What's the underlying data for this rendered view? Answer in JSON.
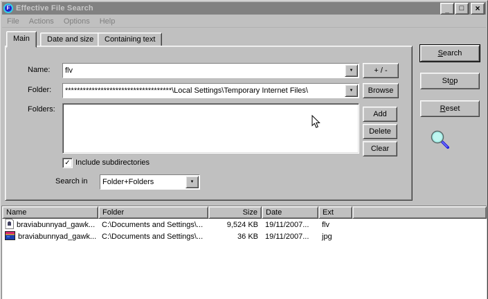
{
  "window": {
    "title": "Effective File Search",
    "icon_letter": "F",
    "controls": {
      "minimize": "_",
      "maximize": "□",
      "close": "×"
    }
  },
  "menu": {
    "items": [
      "File",
      "Actions",
      "Options",
      "Help"
    ]
  },
  "tabs": {
    "main": "Main",
    "date_size": "Date and size",
    "containing": "Containing text"
  },
  "form": {
    "name_label": "Name:",
    "name_value": "flv",
    "plusminus_label": "+ / -",
    "folder_label": "Folder:",
    "folder_value": "************************************\\Local Settings\\Temporary Internet Files\\",
    "browse_label": "Browse",
    "folders_label": "Folders:",
    "add_label": "Add",
    "delete_label": "Delete",
    "clear_label": "Clear",
    "include_sub_label": "Include subdirectories",
    "include_sub_checked": true,
    "search_in_label": "Search in",
    "search_in_value": "Folder+Folders"
  },
  "actions": {
    "search": {
      "pre": "",
      "u": "S",
      "post": "earch"
    },
    "stop": {
      "pre": "St",
      "u": "o",
      "post": "p"
    },
    "reset": {
      "pre": "",
      "u": "R",
      "post": "eset"
    }
  },
  "results": {
    "columns": [
      "Name",
      "Folder",
      "Size",
      "Date",
      "Ext"
    ],
    "rows": [
      {
        "icon": "flv-file-icon",
        "name": "braviabunnyad_gawk...",
        "folder": "C:\\Documents and Settings\\...",
        "size": "9,524 KB",
        "date": "19/11/2007...",
        "ext": "flv"
      },
      {
        "icon": "jpg-file-icon",
        "name": "braviabunnyad_gawk...",
        "folder": "C:\\Documents and Settings\\...",
        "size": "36 KB",
        "date": "19/11/2007...",
        "ext": "jpg"
      }
    ]
  },
  "glyphs": {
    "dropdown": "▼",
    "check": "✓"
  },
  "colors": {
    "titlebar_inactive": "#818181",
    "title_text": "#c9c9c9",
    "button_face": "#c0c0c0",
    "magnifier_lens": "#a8efe8",
    "magnifier_handle": "#2222dd"
  }
}
